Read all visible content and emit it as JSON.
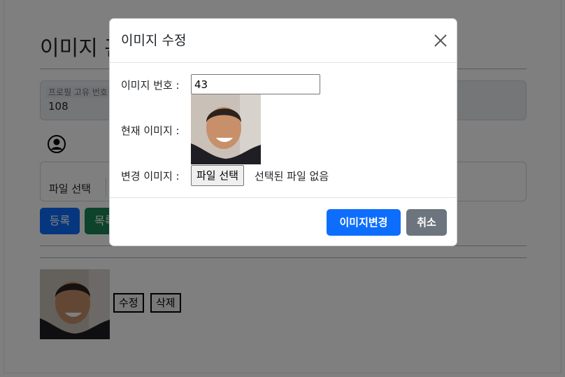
{
  "page": {
    "title": "이미지 관리",
    "profile_label": "프로필 고유 번호",
    "profile_value": "108",
    "file_select_label": "파일 선택",
    "register_label": "등록",
    "list_label": "목록",
    "edit_label": "수정",
    "delete_label": "삭제"
  },
  "modal": {
    "title": "이미지 수정",
    "image_no_label": "이미지 번호 :",
    "image_no_value": "43",
    "current_image_label": "현재 이미지 :",
    "change_image_label": "변경 이미지 :",
    "file_button_label": "파일 선택",
    "file_none_text": "선택된 파일 없음",
    "change_button_label": "이미지변경",
    "cancel_button_label": "취소"
  },
  "icons": {
    "close": "close-icon",
    "user": "user-circle-icon"
  },
  "colors": {
    "primary": "#0d6efd",
    "success": "#198754",
    "secondary": "#6c757d"
  }
}
